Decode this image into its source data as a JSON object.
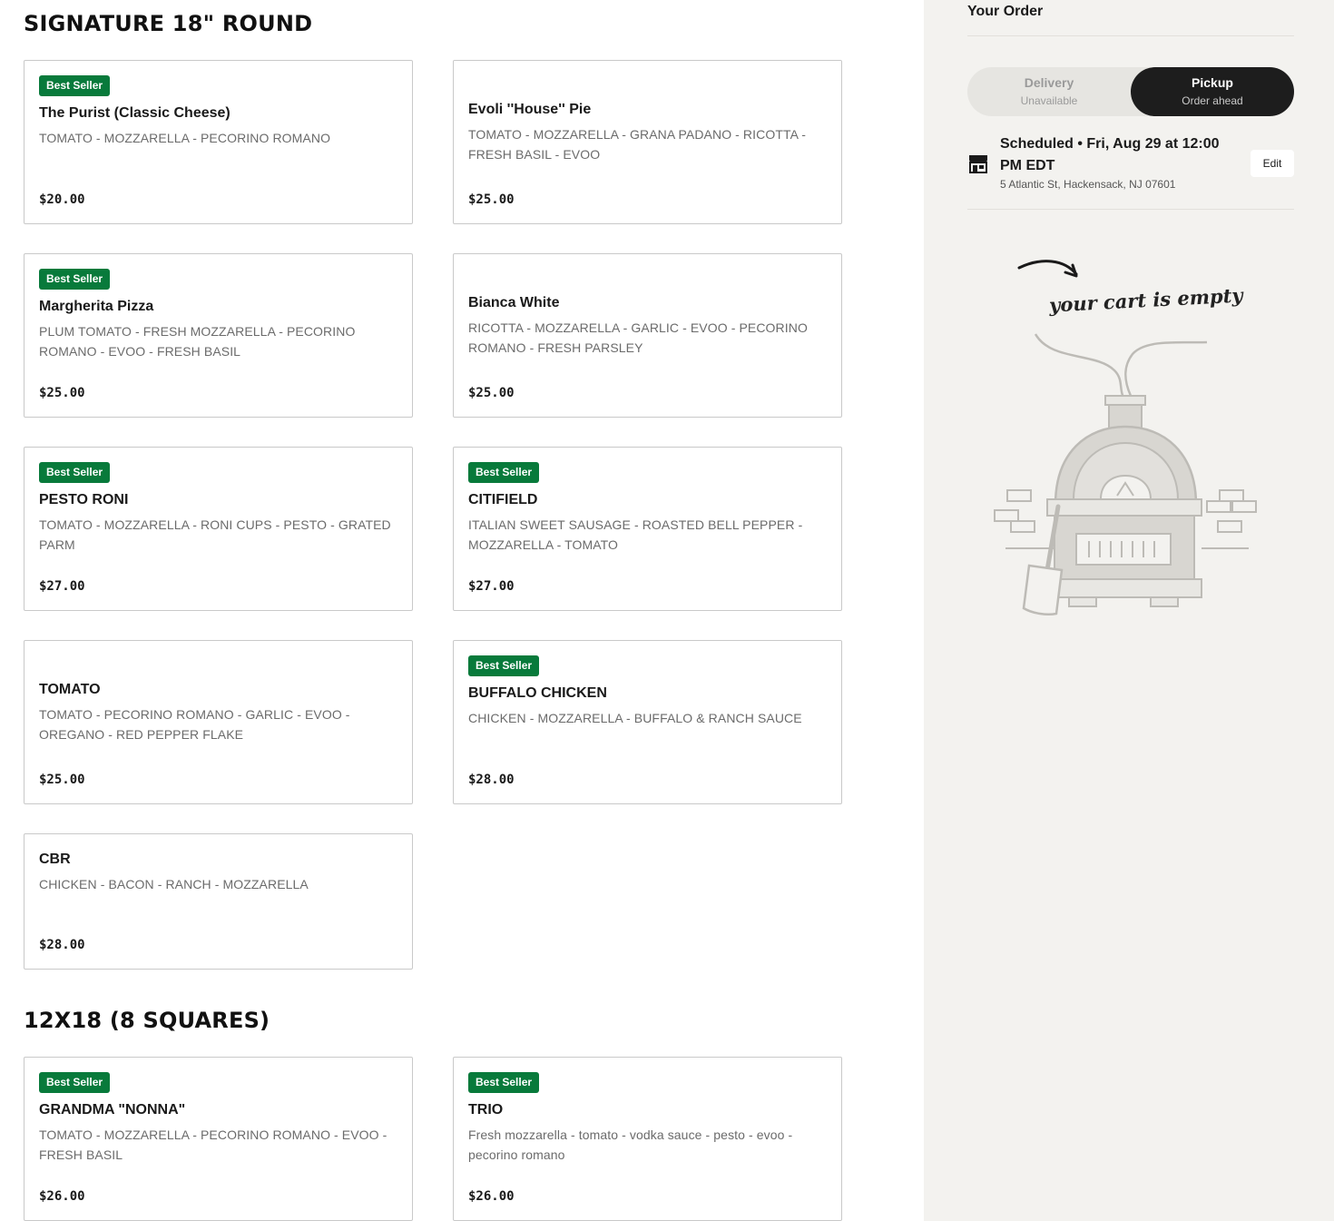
{
  "sections": [
    {
      "title": "SIGNATURE 18\" ROUND",
      "items": [
        {
          "badge": "Best Seller",
          "name": "The Purist (Classic Cheese)",
          "desc": "TOMATO - MOZZARELLA - PECORINO ROMANO",
          "price": "$20.00"
        },
        {
          "badge": "",
          "name": "Evoli ''House'' Pie",
          "desc": "TOMATO - MOZZARELLA - GRANA PADANO - RICOTTA - FRESH BASIL - EVOO",
          "price": "$25.00"
        },
        {
          "badge": "Best Seller",
          "name": "Margherita Pizza",
          "desc": "PLUM TOMATO - FRESH MOZZARELLA - PECORINO ROMANO - EVOO - FRESH BASIL",
          "price": "$25.00"
        },
        {
          "badge": "",
          "name": "Bianca White",
          "desc": "RICOTTA - MOZZARELLA - GARLIC - EVOO - PECORINO ROMANO - FRESH PARSLEY",
          "price": "$25.00"
        },
        {
          "badge": "Best Seller",
          "name": "PESTO RONI",
          "desc": "TOMATO - MOZZARELLA - RONI CUPS - PESTO - GRATED PARM",
          "price": "$27.00"
        },
        {
          "badge": "Best Seller",
          "name": "CITIFIELD",
          "desc": "ITALIAN SWEET SAUSAGE - ROASTED BELL PEPPER - MOZZARELLA - TOMATO",
          "price": "$27.00"
        },
        {
          "badge": "",
          "name": "TOMATO",
          "desc": "TOMATO - PECORINO ROMANO - GARLIC - EVOO - OREGANO - RED PEPPER FLAKE",
          "price": "$25.00"
        },
        {
          "badge": "Best Seller",
          "name": "BUFFALO CHICKEN",
          "desc": "CHICKEN - MOZZARELLA - BUFFALO & RANCH SAUCE",
          "price": "$28.00"
        },
        {
          "badge": "",
          "name": "CBR",
          "desc": "CHICKEN - BACON - RANCH - MOZZARELLA",
          "price": "$28.00"
        }
      ]
    },
    {
      "title": "12X18 (8 SQUARES)",
      "items": [
        {
          "badge": "Best Seller",
          "name": "GRANDMA \"NONNA\"",
          "desc": "TOMATO - MOZZARELLA - PECORINO ROMANO - EVOO - FRESH BASIL",
          "price": "$26.00"
        },
        {
          "badge": "Best Seller",
          "name": "TRIO",
          "desc": "Fresh mozzarella - tomato - vodka sauce - pesto - evoo - pecorino romano",
          "price": "$26.00"
        }
      ]
    }
  ],
  "order": {
    "title": "Your Order",
    "delivery_label": "Delivery",
    "delivery_sub": "Unavailable",
    "pickup_label": "Pickup",
    "pickup_sub": "Order ahead",
    "schedule_title": "Scheduled • Fri, Aug 29 at 12:00 PM EDT",
    "address": "5 Atlantic St, Hackensack, NJ 07601",
    "edit_label": "Edit",
    "empty_text": "your cart is empty"
  },
  "colors": {
    "badge": "#087a3b",
    "pickup_active": "#1d1d1d",
    "sidebar_bg": "#f3f2ef"
  }
}
